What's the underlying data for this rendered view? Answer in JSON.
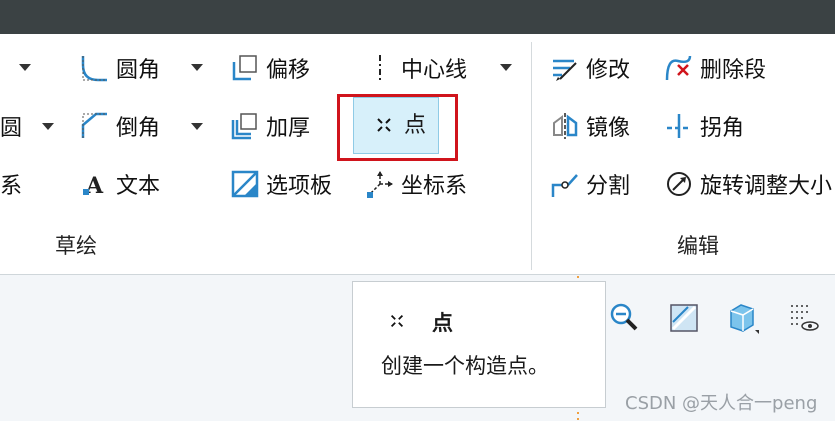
{
  "ribbon": {
    "sketch_group": {
      "label": "草绘",
      "partial_left": [
        "圆",
        "系"
      ],
      "fillet": "圆角",
      "chamfer": "倒角",
      "text": "文本",
      "offset": "偏移",
      "thicken": "加厚",
      "palette": "选项板",
      "centerline": "中心线",
      "point": "点",
      "coordinate_system": "坐标系"
    },
    "edit_group": {
      "label": "编辑",
      "modify": "修改",
      "delete_segment": "删除段",
      "mirror": "镜像",
      "corner": "拐角",
      "divide": "分割",
      "rotate_resize": "旋转调整大小"
    }
  },
  "tooltip": {
    "title": "点",
    "description": "创建一个构造点。"
  },
  "icons": {
    "fillet": "fillet-icon",
    "chamfer": "chamfer-icon",
    "text": "text-icon",
    "offset": "offset-icon",
    "thicken": "thicken-icon",
    "palette": "palette-icon",
    "centerline": "centerline-icon",
    "point": "point-icon",
    "coordinate_system": "coordinate-system-icon",
    "modify": "modify-icon",
    "delete_segment": "delete-segment-icon",
    "mirror": "mirror-icon",
    "corner": "corner-icon",
    "divide": "divide-icon",
    "rotate_resize": "rotate-resize-icon",
    "zoom_out": "zoom-out-icon",
    "repaint": "repaint-icon",
    "display_style": "display-style-icon",
    "datum_display": "datum-display-icon"
  },
  "colors": {
    "accent_blue": "#2a86c8",
    "highlight_red": "#d0141c",
    "selected_bg": "#d7f0fa",
    "topbar": "#3b4244"
  },
  "watermark": "CSDN @天人合一peng"
}
